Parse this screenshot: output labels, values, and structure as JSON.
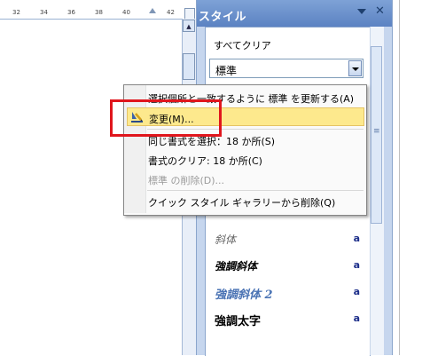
{
  "ruler": {
    "ticks": [
      "32",
      "34",
      "36",
      "38",
      "40",
      "42"
    ]
  },
  "pane": {
    "title": "スタイル",
    "clear_all": "すべてクリア",
    "selected_style": "標準",
    "styles": [
      {
        "name": "斜体",
        "mark": "a"
      },
      {
        "name": "強調斜体",
        "mark": "a"
      },
      {
        "name": "強調斜体 2",
        "mark": "a"
      },
      {
        "name": "強調太字",
        "mark": "a"
      }
    ]
  },
  "context_menu": {
    "items": [
      {
        "label": "選択個所と一致するように 標準 を更新する(A)",
        "enabled": true
      },
      {
        "label": "変更(M)...",
        "enabled": true,
        "highlighted": true
      },
      {
        "label": "同じ書式を選択：18 か所(S)",
        "enabled": true
      },
      {
        "label": "書式のクリア: 18 か所(C)",
        "enabled": true
      },
      {
        "label": "標準 の削除(D)...",
        "enabled": false
      },
      {
        "label": "クイック スタイル ギャラリーから削除(Q)",
        "enabled": true
      }
    ]
  },
  "colors": {
    "highlight": "#fde98d",
    "annotation_box": "#e0161d",
    "pane_header": "#5b82c2"
  }
}
